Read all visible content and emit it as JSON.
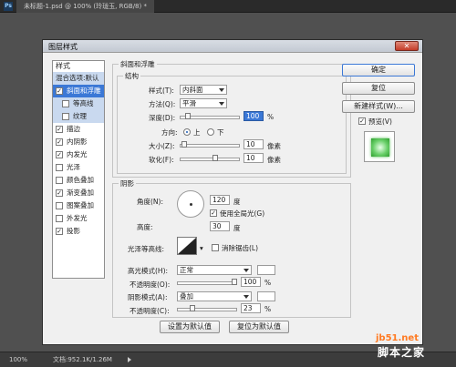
{
  "ps": {
    "logo": "Ps",
    "doc_tab": "未标题-1.psd @ 100% (玲珑玉, RGB/8) *",
    "status_zoom": "100%",
    "status_doc": "文档:952.1K/1.26M"
  },
  "dialog": {
    "title": "图层样式",
    "close": "✕",
    "styles_header": "样式",
    "blend_default": "混合选项:默认",
    "items": [
      {
        "label": "斜面和浮雕",
        "checked": "✓"
      },
      {
        "label": "等高线",
        "checked": ""
      },
      {
        "label": "纹理",
        "checked": ""
      },
      {
        "label": "描边",
        "checked": "✓"
      },
      {
        "label": "内阴影",
        "checked": "✓"
      },
      {
        "label": "内发光",
        "checked": "✓"
      },
      {
        "label": "光泽",
        "checked": ""
      },
      {
        "label": "颜色叠加",
        "checked": ""
      },
      {
        "label": "渐变叠加",
        "checked": "✓"
      },
      {
        "label": "图案叠加",
        "checked": ""
      },
      {
        "label": "外发光",
        "checked": ""
      },
      {
        "label": "投影",
        "checked": "✓"
      }
    ]
  },
  "bevel": {
    "section_title": "斜面和浮雕",
    "structure_title": "结构",
    "style_label": "样式(T):",
    "style_value": "内斜面",
    "technique_label": "方法(Q):",
    "technique_value": "平滑",
    "depth_label": "深度(D):",
    "depth_value": "100",
    "depth_unit": "%",
    "depth_level": 0.1,
    "direction_label": "方向:",
    "dir_up": "上",
    "dir_down": "下",
    "size_label": "大小(Z):",
    "size_value": "10",
    "size_unit": "像素",
    "size_level": 0.04,
    "soften_label": "软化(F):",
    "soften_value": "10",
    "soften_unit": "像素",
    "soften_level": 0.6
  },
  "shading": {
    "title": "阴影",
    "angle_label": "角度(N):",
    "angle_value": "120",
    "angle_unit": "度",
    "global_light_label": "使用全局光(G)",
    "altitude_label": "高度:",
    "altitude_value": "30",
    "altitude_unit": "度",
    "gloss_label": "光泽等高线:",
    "antialias_label": "消除锯齿(L)",
    "highlight_mode_label": "高光模式(H):",
    "highlight_mode_value": "正常",
    "highlight_opacity_label": "不透明度(O):",
    "highlight_opacity_value": "100",
    "highlight_opacity_unit": "%",
    "highlight_level": 1.0,
    "shadow_mode_label": "阴影模式(A):",
    "shadow_mode_value": "叠加",
    "shadow_opacity_label": "不透明度(C):",
    "shadow_opacity_value": "23",
    "shadow_opacity_unit": "%",
    "shadow_level": 0.23
  },
  "footer": {
    "set_default": "设置为默认值",
    "reset_default": "复位为默认值"
  },
  "right_buttons": {
    "ok": "确定",
    "reset": "复位",
    "new_style": "新建样式(W)...",
    "preview": "预览(V)"
  },
  "watermark": {
    "url": "jb51.net",
    "name": "脚本之家"
  }
}
